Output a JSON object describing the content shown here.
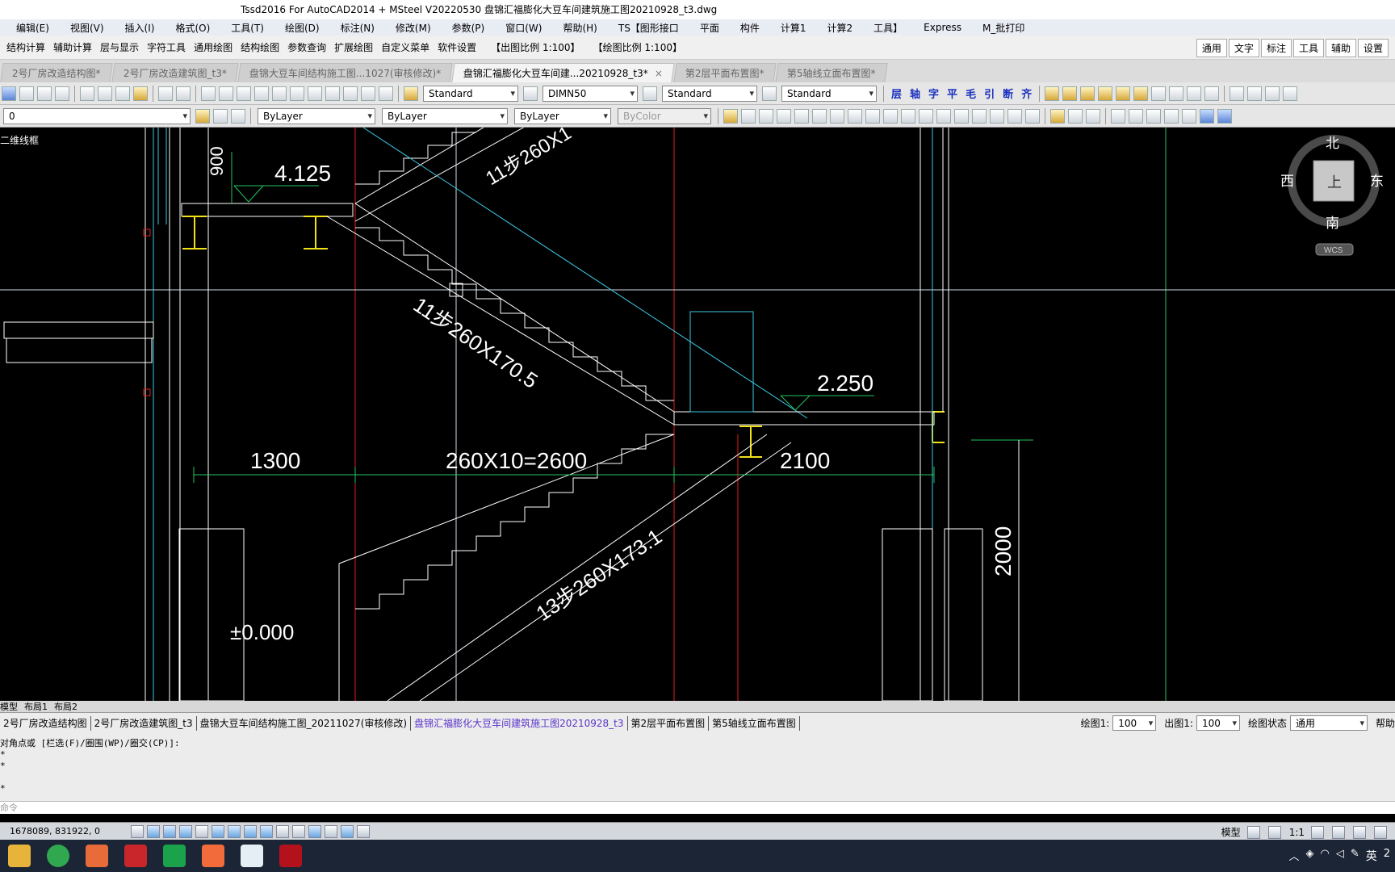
{
  "window": {
    "title": "Tssd2016 For AutoCAD2014 + MSteel V20220530    盘锦汇福膨化大豆车间建筑施工图20210928_t3.dwg"
  },
  "menu": [
    "编辑(E)",
    "视图(V)",
    "插入(I)",
    "格式(O)",
    "工具(T)",
    "绘图(D)",
    "标注(N)",
    "修改(M)",
    "参数(P)",
    "窗口(W)",
    "帮助(H)",
    "TS【图形接口",
    "平面",
    "构件",
    "计算1",
    "计算2",
    "工具】",
    "Express",
    "M_批打印"
  ],
  "ribbon": {
    "items": [
      "结构计算",
      "辅助计算",
      "层与显示",
      "字符工具",
      "通用绘图",
      "结构绘图",
      "参数查询",
      "扩展绘图",
      "自定义菜单",
      "软件设置"
    ],
    "print_scale": "【出图比例 1:100】",
    "draw_scale": "【绘图比例 1:100】",
    "right_buttons": [
      "通用",
      "文字",
      "标注",
      "工具",
      "辅助",
      "设置"
    ]
  },
  "doc_tabs": [
    {
      "label": "2号厂房改造结构图*",
      "active": false
    },
    {
      "label": "2号厂房改造建筑图_t3*",
      "active": false
    },
    {
      "label": "盘锦大豆车间结构施工图...1027(审核修改)*",
      "active": false
    },
    {
      "label": "盘锦汇福膨化大豆车间建...20210928_t3*",
      "active": true
    },
    {
      "label": "第2层平面布置图*",
      "active": false
    },
    {
      "label": "第5轴线立面布置图*",
      "active": false
    }
  ],
  "toolbar1": {
    "text_style": "Standard",
    "dim_style": "DIMN50",
    "table_style": "Standard",
    "multileader_style": "Standard",
    "cjk_tools": [
      "层",
      "轴",
      "字",
      "平",
      "毛",
      "引",
      "断",
      "齐"
    ]
  },
  "toolbar2": {
    "layer": "0",
    "color": "ByLayer",
    "linetype": "ByLayer",
    "lineweight": "ByLayer",
    "plotstyle": "ByColor"
  },
  "canvas": {
    "viewport_label": "二维线框",
    "labels": {
      "elev_top": "4.125",
      "dim_900": "900",
      "stair_top": "11步260X1",
      "stair_mid": "11步260X170.5",
      "stair_low": "13步260X173.1",
      "elev_mid": "2.250",
      "dim_1300": "1300",
      "dim_2600": "260X10=2600",
      "dim_2100": "2100",
      "dim_2000": "2000",
      "elev_bottom": "±0.000"
    },
    "viewcube": {
      "north": "北",
      "south": "南",
      "east": "东",
      "west": "西",
      "face": "上",
      "wcs": "WCS"
    }
  },
  "layout_tabs": [
    "模型",
    "布局1",
    "布局2"
  ],
  "drawing_tabs": [
    {
      "label": "2号厂房改造结构图",
      "active": false
    },
    {
      "label": "2号厂房改造建筑图_t3",
      "active": false
    },
    {
      "label": "盘锦大豆车间结构施工图_20211027(审核修改)",
      "active": false
    },
    {
      "label": "盘锦汇福膨化大豆车间建筑施工图20210928_t3",
      "active": true
    },
    {
      "label": "第2层平面布置图",
      "active": false
    },
    {
      "label": "第5轴线立面布置图",
      "active": false
    }
  ],
  "scale_controls": {
    "draw_label": "绘图1:",
    "draw_value": "100",
    "out_label": "出图1:",
    "out_value": "100",
    "state_label": "绘图状态",
    "state_value": "通用",
    "help": "帮助"
  },
  "command": {
    "lines": [
      "对角点或 [栏选(F)/圈围(WP)/圈交(CP)]:",
      "*",
      "*",
      "",
      "*"
    ],
    "prompt": "命令"
  },
  "status": {
    "coords": "1678089, 831922, 0",
    "model": "模型",
    "anno_scale": "1:1"
  },
  "tray": {
    "ime": "英",
    "time": "2"
  },
  "colors": {
    "canvas_bg": "#000000",
    "dim_green": "#22c55e",
    "beam_yellow": "#f2e21a",
    "axis_red": "#e11d1d",
    "cyan": "#3ec9e6"
  }
}
